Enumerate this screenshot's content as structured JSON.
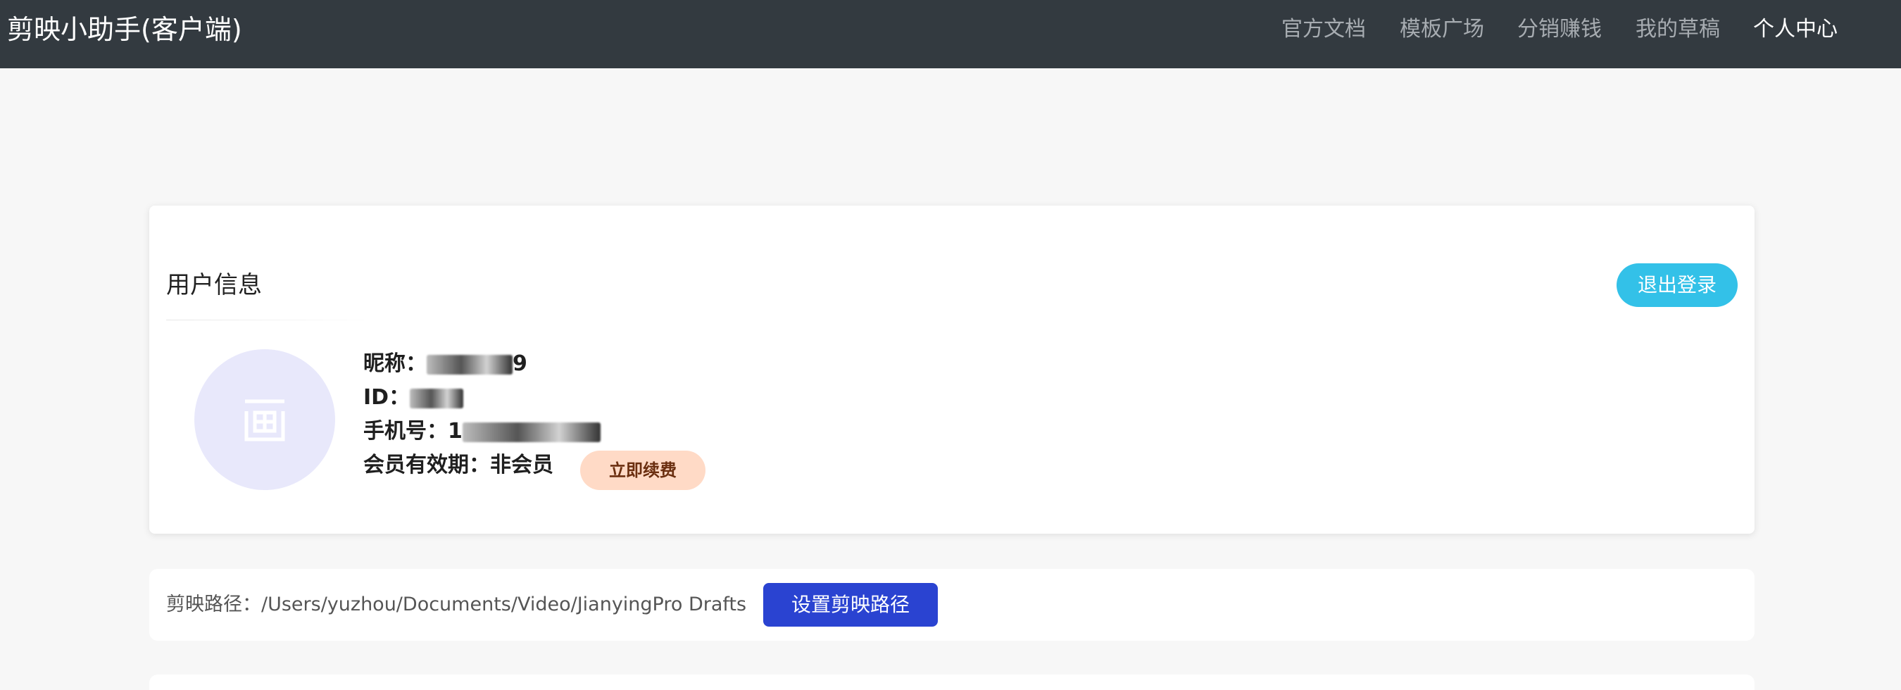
{
  "navbar": {
    "brand": "剪映小助手(客户端)",
    "links": [
      {
        "label": "官方文档"
      },
      {
        "label": "模板广场"
      },
      {
        "label": "分销赚钱"
      },
      {
        "label": "我的草稿"
      },
      {
        "label": "个人中心",
        "active": true
      }
    ]
  },
  "user_card": {
    "title": "用户信息",
    "logout_label": "退出登录",
    "avatar_icon": "image-placeholder-icon",
    "nickname_label": "昵称：",
    "nickname_value_visible": "9",
    "id_label": "ID：",
    "phone_label": "手机号：",
    "phone_value_visible": "1",
    "membership_label": "会员有效期：",
    "membership_value": "非会员",
    "renew_label": "立即续费"
  },
  "path_card": {
    "path_label": "剪映路径：",
    "path_value": "/Users/yuzhou/Documents/Video/JianyingPro Drafts",
    "set_path_label": "设置剪映路径"
  },
  "colors": {
    "navbar_bg": "#333a40",
    "logout_btn": "#33c1e8",
    "set_path_btn": "#2a43d1",
    "renew_btn": "#ffdac6",
    "avatar_bg": "#e8e8fb"
  }
}
